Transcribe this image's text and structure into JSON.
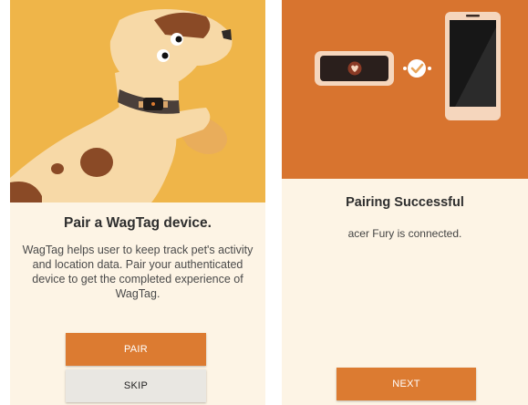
{
  "pair_screen": {
    "title": "Pair a WagTag device.",
    "description": "WagTag helps user to keep track pet's activity and location data. Pair your authenticated device to get the completed experience of WagTag.",
    "pair_label": "PAIR",
    "skip_label": "SKIP"
  },
  "success_screen": {
    "title": "Pairing Successful",
    "status": "acer Fury is connected.",
    "next_label": "NEXT"
  },
  "colors": {
    "hero_yellow": "#efb549",
    "hero_orange": "#d8742f",
    "accent": "#dc7b31",
    "background": "#fdf4e5",
    "dog_body": "#f7d9a7",
    "dog_spot": "#8a4a26",
    "skip_gray": "#e9e7e2"
  },
  "icons": {
    "dog": "dog-illustration",
    "tag": "wagtag-device-icon",
    "check": "check-icon",
    "phone": "smartphone-icon"
  }
}
